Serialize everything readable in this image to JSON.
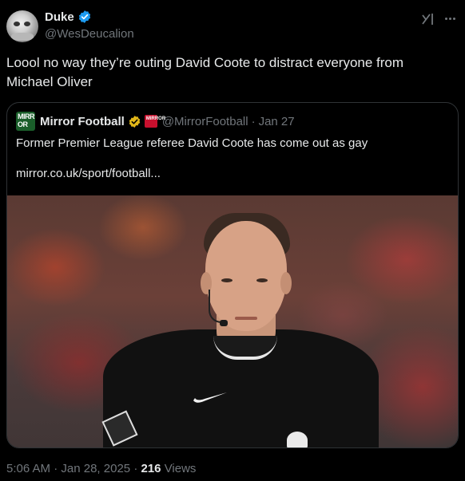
{
  "author": {
    "name": "Duke",
    "handle": "@WesDeucalion",
    "verified_color": "#1d9bf0"
  },
  "tweet": {
    "text_line1": "Loool no way they’re outing David Coote to distract everyone from",
    "text_line2": "Michael Oliver"
  },
  "quote": {
    "name": "Mirror Football",
    "handle": "@MirrorFootball",
    "separator": "·",
    "date": "Jan 27",
    "text": "Former Premier League referee David Coote has come out as gay",
    "link": "mirror.co.uk/sport/football...",
    "logo_text_top": "MIRR",
    "logo_text_bottom": "OR",
    "gold_badge_color": "#e2b719",
    "mini_logo_text": "MIRROR"
  },
  "meta": {
    "time": "5:06 AM",
    "separator1": "·",
    "date": "Jan 28, 2025",
    "separator2": "·",
    "views_count": "216",
    "views_label": "Views"
  },
  "icons": {
    "grok": "grok-icon",
    "more": "more-icon"
  }
}
